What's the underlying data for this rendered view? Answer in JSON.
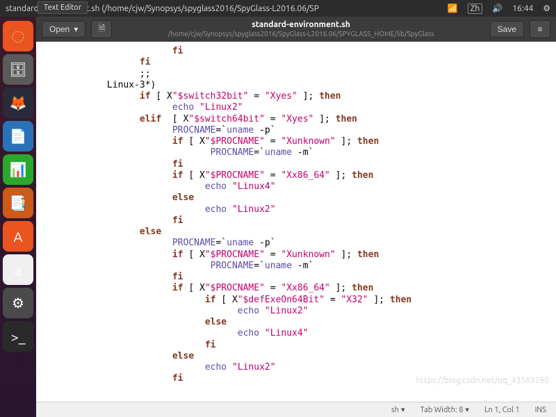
{
  "topbar": {
    "title": "standard-environment.sh (/home/cjw/Synopsys/spyglass2016/SpyGlass-L2016.06/SP",
    "tooltip": "Text Editor",
    "input_method": "Zh",
    "time": "16:44"
  },
  "toolbar": {
    "open_label": "Open",
    "save_label": "Save",
    "filename": "standard-environment.sh",
    "filepath": "/home/cjw/Synopsys/spyglass2016/SpyGlass-L2016.06/SPYGLASS_HOME/lib/SpyGlass"
  },
  "code": {
    "lines": [
      {
        "indent": 24,
        "parts": [
          {
            "t": "fi",
            "c": "kw"
          }
        ]
      },
      {
        "indent": 18,
        "parts": [
          {
            "t": "fi",
            "c": "kw"
          }
        ]
      },
      {
        "indent": 18,
        "parts": [
          {
            "t": ";;",
            "c": ""
          }
        ]
      },
      {
        "indent": 12,
        "parts": [
          {
            "t": "Linux-3*",
            "c": ""
          },
          {
            "t": ")",
            "c": ""
          }
        ]
      },
      {
        "indent": 18,
        "parts": [
          {
            "t": "if",
            "c": "kw"
          },
          {
            "t": " [ X",
            "c": ""
          },
          {
            "t": "\"$switch32bit\"",
            "c": "str"
          },
          {
            "t": " = ",
            "c": ""
          },
          {
            "t": "\"Xyes\"",
            "c": "str"
          },
          {
            "t": " ]; ",
            "c": ""
          },
          {
            "t": "then",
            "c": "kw"
          }
        ]
      },
      {
        "indent": 24,
        "parts": [
          {
            "t": "echo ",
            "c": "cmd"
          },
          {
            "t": "\"Linux2\"",
            "c": "str"
          }
        ]
      },
      {
        "indent": 18,
        "parts": [
          {
            "t": "elif",
            "c": "kw"
          },
          {
            "t": "  [ X",
            "c": ""
          },
          {
            "t": "\"$switch64bit\"",
            "c": "str"
          },
          {
            "t": " = ",
            "c": ""
          },
          {
            "t": "\"Xyes\"",
            "c": "str"
          },
          {
            "t": " ]; ",
            "c": ""
          },
          {
            "t": "then",
            "c": "kw"
          }
        ]
      },
      {
        "indent": 24,
        "parts": [
          {
            "t": "PROCNAME",
            "c": "var"
          },
          {
            "t": "=`",
            "c": ""
          },
          {
            "t": "uname",
            "c": "cmd"
          },
          {
            "t": " -p`",
            "c": ""
          }
        ]
      },
      {
        "indent": 24,
        "parts": [
          {
            "t": "if",
            "c": "kw"
          },
          {
            "t": " [ X",
            "c": ""
          },
          {
            "t": "\"$PROCNAME\"",
            "c": "str"
          },
          {
            "t": " = ",
            "c": ""
          },
          {
            "t": "\"Xunknown\"",
            "c": "str"
          },
          {
            "t": " ]; ",
            "c": ""
          },
          {
            "t": "then",
            "c": "kw"
          }
        ]
      },
      {
        "indent": 31,
        "parts": [
          {
            "t": "PROCNAME",
            "c": "var"
          },
          {
            "t": "=`",
            "c": ""
          },
          {
            "t": "uname",
            "c": "cmd"
          },
          {
            "t": " -m`",
            "c": ""
          }
        ]
      },
      {
        "indent": 24,
        "parts": [
          {
            "t": "fi",
            "c": "kw"
          }
        ]
      },
      {
        "indent": 24,
        "parts": [
          {
            "t": "if",
            "c": "kw"
          },
          {
            "t": " [ X",
            "c": ""
          },
          {
            "t": "\"$PROCNAME\"",
            "c": "str"
          },
          {
            "t": " = ",
            "c": ""
          },
          {
            "t": "\"Xx86_64\"",
            "c": "str"
          },
          {
            "t": " ]; ",
            "c": ""
          },
          {
            "t": "then",
            "c": "kw"
          }
        ]
      },
      {
        "indent": 30,
        "parts": [
          {
            "t": "echo ",
            "c": "cmd"
          },
          {
            "t": "\"Linux4\"",
            "c": "str"
          }
        ]
      },
      {
        "indent": 24,
        "parts": [
          {
            "t": "else",
            "c": "kw"
          }
        ]
      },
      {
        "indent": 30,
        "parts": [
          {
            "t": "echo ",
            "c": "cmd"
          },
          {
            "t": "\"Linux2\"",
            "c": "str"
          }
        ]
      },
      {
        "indent": 24,
        "parts": [
          {
            "t": "fi",
            "c": "kw"
          }
        ]
      },
      {
        "indent": 18,
        "parts": [
          {
            "t": "else",
            "c": "kw"
          }
        ]
      },
      {
        "indent": 24,
        "parts": [
          {
            "t": "PROCNAME",
            "c": "var"
          },
          {
            "t": "=`",
            "c": ""
          },
          {
            "t": "uname",
            "c": "cmd"
          },
          {
            "t": " -p`",
            "c": ""
          }
        ]
      },
      {
        "indent": 24,
        "parts": [
          {
            "t": "if",
            "c": "kw"
          },
          {
            "t": " [ X",
            "c": ""
          },
          {
            "t": "\"$PROCNAME\"",
            "c": "str"
          },
          {
            "t": " = ",
            "c": ""
          },
          {
            "t": "\"Xunknown\"",
            "c": "str"
          },
          {
            "t": " ]; ",
            "c": ""
          },
          {
            "t": "then",
            "c": "kw"
          }
        ]
      },
      {
        "indent": 31,
        "parts": [
          {
            "t": "PROCNAME",
            "c": "var"
          },
          {
            "t": "=`",
            "c": ""
          },
          {
            "t": "uname",
            "c": "cmd"
          },
          {
            "t": " -m`",
            "c": ""
          }
        ]
      },
      {
        "indent": 24,
        "parts": [
          {
            "t": "fi",
            "c": "kw"
          }
        ]
      },
      {
        "indent": 24,
        "parts": [
          {
            "t": "if",
            "c": "kw"
          },
          {
            "t": " [ X",
            "c": ""
          },
          {
            "t": "\"$PROCNAME\"",
            "c": "str"
          },
          {
            "t": " = ",
            "c": ""
          },
          {
            "t": "\"Xx86_64\"",
            "c": "str"
          },
          {
            "t": " ]; ",
            "c": ""
          },
          {
            "t": "then",
            "c": "kw"
          }
        ]
      },
      {
        "indent": 30,
        "parts": [
          {
            "t": "if",
            "c": "kw"
          },
          {
            "t": " [ X",
            "c": ""
          },
          {
            "t": "\"$defExeOn64Bit\"",
            "c": "str"
          },
          {
            "t": " = ",
            "c": ""
          },
          {
            "t": "\"X32\"",
            "c": "str"
          },
          {
            "t": " ]; ",
            "c": ""
          },
          {
            "t": "then",
            "c": "kw"
          }
        ]
      },
      {
        "indent": 36,
        "parts": [
          {
            "t": "echo ",
            "c": "cmd"
          },
          {
            "t": "\"Linux2\"",
            "c": "str"
          }
        ]
      },
      {
        "indent": 30,
        "parts": [
          {
            "t": "else",
            "c": "kw"
          }
        ]
      },
      {
        "indent": 36,
        "parts": [
          {
            "t": "echo ",
            "c": "cmd"
          },
          {
            "t": "\"Linux4\"",
            "c": "str"
          }
        ]
      },
      {
        "indent": 30,
        "parts": [
          {
            "t": "fi",
            "c": "kw"
          }
        ]
      },
      {
        "indent": 24,
        "parts": [
          {
            "t": "else",
            "c": "kw"
          }
        ]
      },
      {
        "indent": 30,
        "parts": [
          {
            "t": "echo ",
            "c": "cmd"
          },
          {
            "t": "\"Linux2\"",
            "c": "str"
          }
        ]
      },
      {
        "indent": 24,
        "parts": [
          {
            "t": "fi",
            "c": "kw"
          }
        ]
      }
    ]
  },
  "statusbar": {
    "language": "sh",
    "tabwidth": "Tab Width: 8",
    "cursor": "Ln 1, Col 1",
    "insert": "INS"
  },
  "launcher": {
    "items": [
      {
        "name": "ubuntu-dash",
        "bg": "#e95420",
        "g": "◌"
      },
      {
        "name": "files",
        "bg": "#5a5a5a",
        "g": "🗄"
      },
      {
        "name": "firefox",
        "bg": "#2a2a3a",
        "g": "🦊"
      },
      {
        "name": "writer",
        "bg": "#2a72b8",
        "g": "📄"
      },
      {
        "name": "calc",
        "bg": "#2aa82a",
        "g": "📊"
      },
      {
        "name": "impress",
        "bg": "#cc5a1a",
        "g": "📑"
      },
      {
        "name": "software",
        "bg": "#e95420",
        "g": "A"
      },
      {
        "name": "amazon",
        "bg": "#f0f0f0",
        "g": "a"
      },
      {
        "name": "settings",
        "bg": "#4a4a4a",
        "g": "⚙"
      },
      {
        "name": "terminal",
        "bg": "#2a2a2a",
        "g": ">_"
      }
    ]
  },
  "watermark": "https://blog.csdn.net/qq_43589290"
}
